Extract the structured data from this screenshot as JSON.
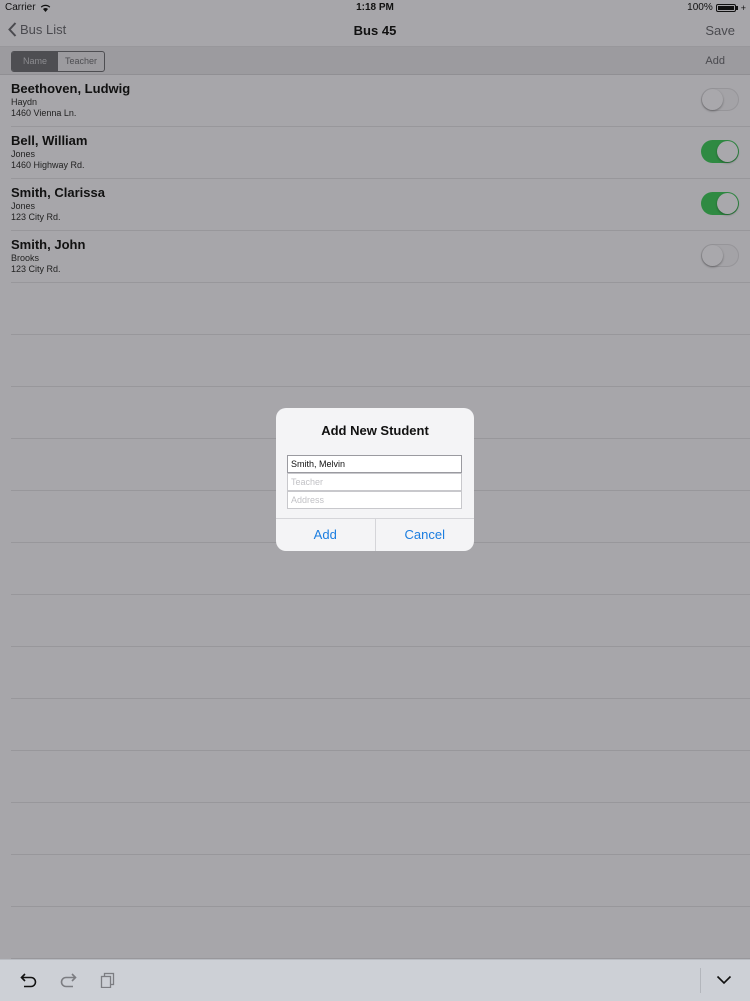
{
  "status": {
    "carrier": "Carrier",
    "time": "1:18 PM",
    "battery": "100%"
  },
  "nav": {
    "back_label": "Bus List",
    "title": "Bus 45",
    "save_label": "Save"
  },
  "toolbar": {
    "segments": [
      "Name",
      "Teacher"
    ],
    "selected_segment": "Name",
    "add_label": "Add"
  },
  "students": [
    {
      "name": "Beethoven, Ludwig",
      "teacher": "Haydn",
      "address": "1460 Vienna Ln.",
      "on": false
    },
    {
      "name": "Bell, William",
      "teacher": "Jones",
      "address": "1460 Highway Rd.",
      "on": true
    },
    {
      "name": "Smith, Clarissa",
      "teacher": "Jones",
      "address": "123 City Rd.",
      "on": true
    },
    {
      "name": "Smith, John",
      "teacher": "Brooks",
      "address": "123 City Rd.",
      "on": false
    }
  ],
  "alert": {
    "title": "Add New Student",
    "fields": [
      {
        "value": "Smith, Melvin",
        "placeholder": ""
      },
      {
        "value": "",
        "placeholder": "Teacher"
      },
      {
        "value": "",
        "placeholder": "Address"
      }
    ],
    "add_label": "Add",
    "cancel_label": "Cancel"
  },
  "colors": {
    "toggle_on": "#2f8a42",
    "alert_button": "#1c7ee0",
    "dim_background": "#a7a6aa"
  },
  "keyboard_bar": {
    "icons": [
      "undo-icon",
      "redo-icon",
      "paste-icon",
      "hide-keyboard-icon"
    ]
  }
}
